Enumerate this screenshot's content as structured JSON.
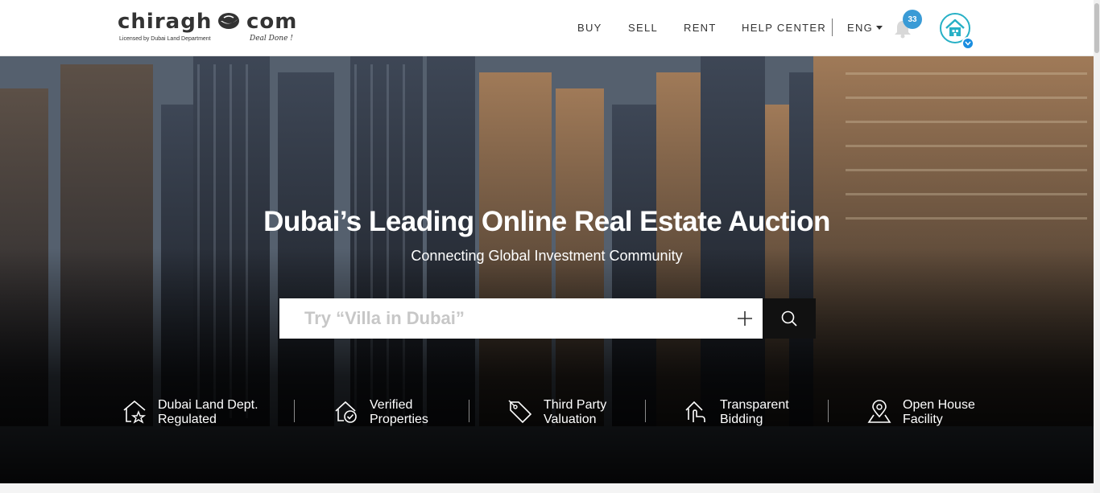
{
  "brand": {
    "name_left": "chiragh",
    "name_right": "com",
    "license": "Licensed by Dubai Land Department",
    "tagline": "Deal Done !"
  },
  "nav": {
    "items": [
      {
        "label": "BUY"
      },
      {
        "label": "SELL"
      },
      {
        "label": "RENT"
      },
      {
        "label": "HELP CENTER"
      }
    ],
    "language": "ENG",
    "notification_count": "33"
  },
  "hero": {
    "title": "Dubai’s Leading Online Real Estate Auction",
    "subtitle": "Connecting Global Investment Community",
    "search_placeholder": "Try “Villa in Dubai”"
  },
  "features": [
    {
      "line1": "Dubai Land Dept.",
      "line2": "Regulated",
      "icon": "house-star-icon"
    },
    {
      "line1": "Verified",
      "line2": "Properties",
      "icon": "house-check-icon"
    },
    {
      "line1": "Third Party",
      "line2": "Valuation",
      "icon": "price-tag-icon"
    },
    {
      "line1": "Transparent",
      "line2": "Bidding",
      "icon": "hand-bid-icon"
    },
    {
      "line1": "Open House",
      "line2": "Facility",
      "icon": "map-pin-icon"
    }
  ],
  "colors": {
    "accent_blue": "#3a9bd6",
    "avatar_ring": "#27b0c6",
    "search_button": "#111111",
    "nav_text": "#333333"
  }
}
